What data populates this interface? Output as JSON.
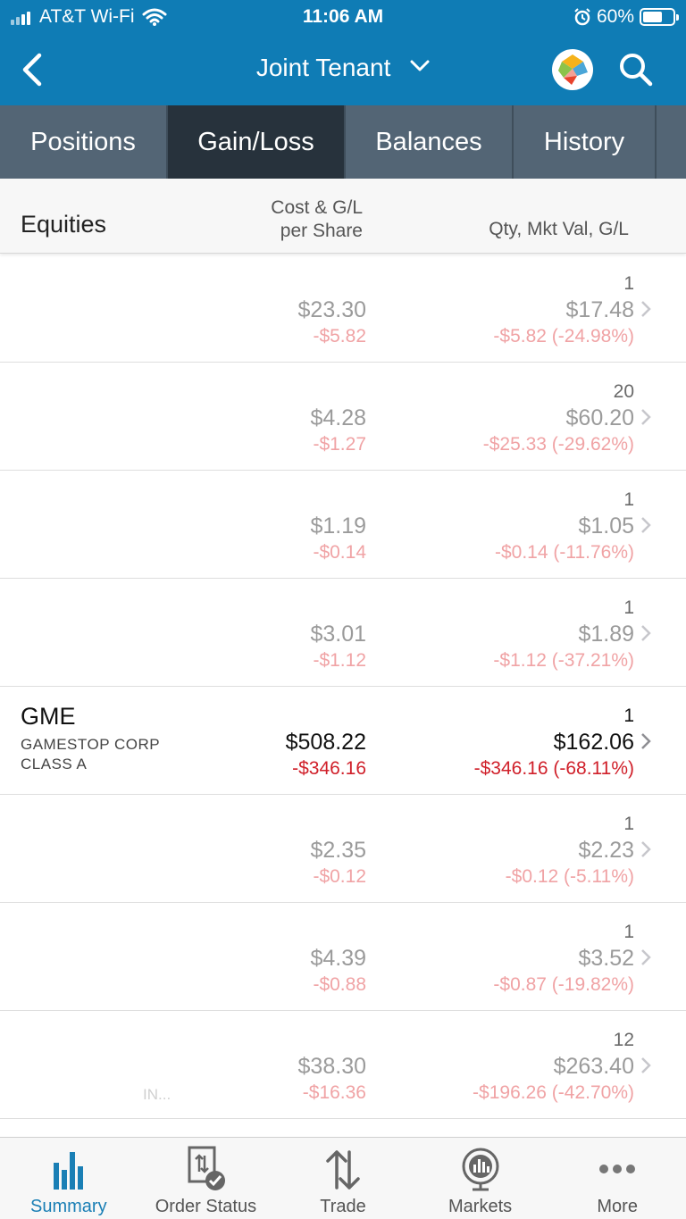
{
  "status_bar": {
    "carrier": "AT&T Wi-Fi",
    "time": "11:06 AM",
    "battery": "60%"
  },
  "header": {
    "title": "Joint Tenant",
    "back_icon": "chevron-left-icon",
    "logo_icon": "brand-logo-icon",
    "search_icon": "search-icon"
  },
  "tabs": [
    {
      "label": "Positions",
      "active": false
    },
    {
      "label": "Gain/Loss",
      "active": true
    },
    {
      "label": "Balances",
      "active": false
    },
    {
      "label": "History",
      "active": false
    }
  ],
  "columns": {
    "section": "Equities",
    "cost_line1": "Cost & G/L",
    "cost_line2": "per Share",
    "qty": "Qty, Mkt Val, G/L"
  },
  "rows": [
    {
      "symbol": "",
      "desc1": "",
      "desc2": "",
      "cost": "$23.30",
      "cost_gl": "-$5.82",
      "qty": "1",
      "mkt_val": "$17.48",
      "gl": "-$5.82 (-24.98%)",
      "highlight": false
    },
    {
      "symbol": "",
      "desc1": "",
      "desc2": "",
      "cost": "$4.28",
      "cost_gl": "-$1.27",
      "qty": "20",
      "mkt_val": "$60.20",
      "gl": "-$25.33 (-29.62%)",
      "highlight": false
    },
    {
      "symbol": "",
      "desc1": "",
      "desc2": "",
      "cost": "$1.19",
      "cost_gl": "-$0.14",
      "qty": "1",
      "mkt_val": "$1.05",
      "gl": "-$0.14 (-11.76%)",
      "highlight": false
    },
    {
      "symbol": "",
      "desc1": "",
      "desc2": "",
      "cost": "$3.01",
      "cost_gl": "-$1.12",
      "qty": "1",
      "mkt_val": "$1.89",
      "gl": "-$1.12 (-37.21%)",
      "highlight": false
    },
    {
      "symbol": "GME",
      "desc1": "GAMESTOP CORP",
      "desc2": "CLASS A",
      "cost": "$508.22",
      "cost_gl": "-$346.16",
      "qty": "1",
      "mkt_val": "$162.06",
      "gl": "-$346.16 (-68.11%)",
      "highlight": true
    },
    {
      "symbol": "",
      "desc1": "",
      "desc2": "",
      "cost": "$2.35",
      "cost_gl": "-$0.12",
      "qty": "1",
      "mkt_val": "$2.23",
      "gl": "-$0.12 (-5.11%)",
      "highlight": false
    },
    {
      "symbol": "",
      "desc1": "",
      "desc2": "",
      "cost": "$4.39",
      "cost_gl": "-$0.88",
      "qty": "1",
      "mkt_val": "$3.52",
      "gl": "-$0.87 (-19.82%)",
      "highlight": false
    },
    {
      "symbol": "",
      "desc1": "",
      "desc2": "",
      "cost": "$38.30",
      "cost_gl": "-$16.36",
      "qty": "12",
      "mkt_val": "$263.40",
      "gl": "-$196.26 (-42.70%)",
      "highlight": false,
      "trailing": "IN..."
    }
  ],
  "bottom_nav": [
    {
      "label": "Summary",
      "icon": "bar-chart-icon",
      "active": true
    },
    {
      "label": "Order Status",
      "icon": "order-status-icon",
      "active": false
    },
    {
      "label": "Trade",
      "icon": "trade-arrows-icon",
      "active": false
    },
    {
      "label": "Markets",
      "icon": "globe-chart-icon",
      "active": false
    },
    {
      "label": "More",
      "icon": "more-dots-icon",
      "active": false
    }
  ],
  "colors": {
    "header_blue": "#0f7cb5",
    "tab_bg": "#536575",
    "tab_active": "#27323c",
    "loss_red": "#d0202a",
    "loss_red_faded": "#f0a3a5",
    "nav_active": "#1a7fb5"
  }
}
